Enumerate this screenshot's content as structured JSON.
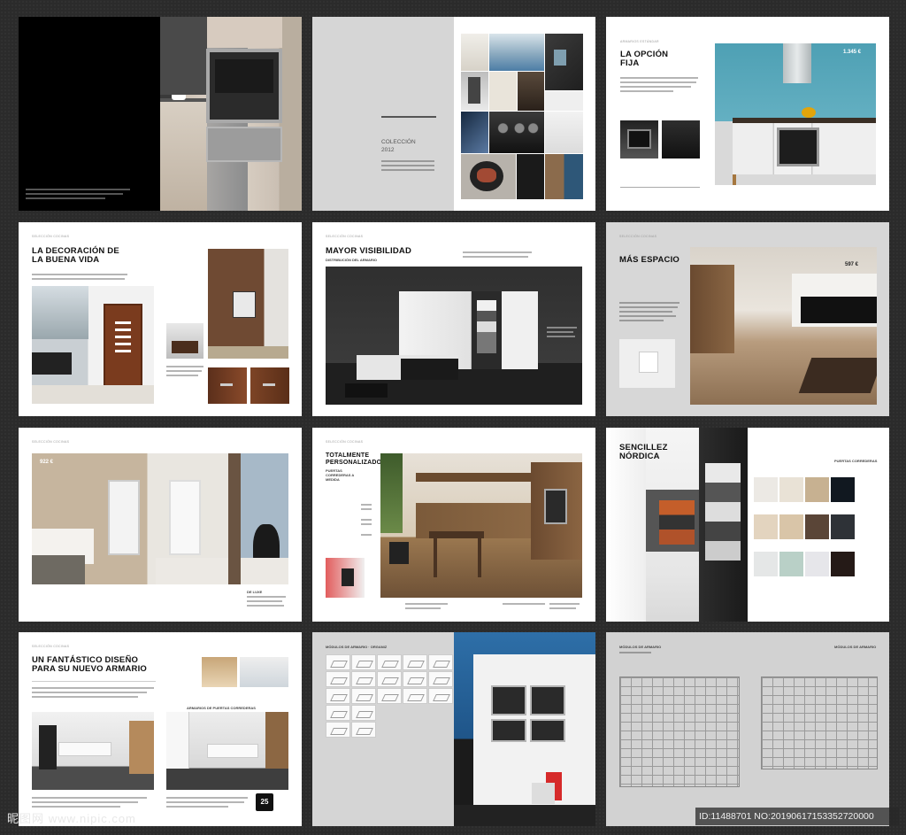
{
  "spreads": {
    "s1": {
      "caption_lines": 3
    },
    "s2": {
      "title": "COLECCIÓN 2012"
    },
    "s3": {
      "runhead": "ARMARIOS ESTÁNDAR",
      "title": "LA OPCIÓN FIJA",
      "price": "1.345 €"
    },
    "s4": {
      "runhead": "SELECCIÓN COCINAS",
      "title": "LA DECORACIÓN DE LA BUENA VIDA"
    },
    "s5": {
      "runhead": "SELECCIÓN COCINAS",
      "title": "MAYOR VISIBILIDAD",
      "subtitle": "DISTRIBUCIÓN DEL ARMARIO"
    },
    "s6": {
      "runhead": "SELECCIÓN COCINAS",
      "title": "MÁS ESPACIO",
      "price": "597 €"
    },
    "s7": {
      "runhead": "SELECCIÓN COCINAS",
      "price": "922 €",
      "label": "DE LUXE"
    },
    "s8": {
      "runhead": "SELECCIÓN COCINAS",
      "title": "TOTALMENTE PERSONALIZADO",
      "subtitle": "PUERTAS CORREDERAS A MEDIDA"
    },
    "s9": {
      "title": "SENCILLEZ NÓRDICA",
      "label": "PUERTAS CORREDERAS"
    },
    "s10": {
      "runhead": "SELECCIÓN COCINAS",
      "title": "UN FANTÁSTICO DISEÑO PARA SU NUEVO ARMARIO",
      "label": "ARMARIOS DE PUERTAS CORREDERAS",
      "badge": "25"
    },
    "s11": {
      "label": "MÓDULOS DE ARMARIO · ORGANIZ"
    },
    "s12": {
      "label_left": "MÓDULOS DE ARMARIO",
      "label_right": "MÓDULOS DE ARMARIO"
    }
  },
  "colors": {
    "swatches": [
      "#ece9e4",
      "#e9e2d6",
      "#c7b191",
      "#111820",
      "#e3d4bf",
      "#d9c5a8",
      "#5a4537",
      "#2e3237",
      "#e5e7e7",
      "#b9d0c7",
      "#e6e6ea",
      "#251a17"
    ]
  },
  "watermark": {
    "site": "昵图网",
    "url": "www.nipic.com",
    "id": "ID:11488701 NO:20190617153352720000"
  }
}
